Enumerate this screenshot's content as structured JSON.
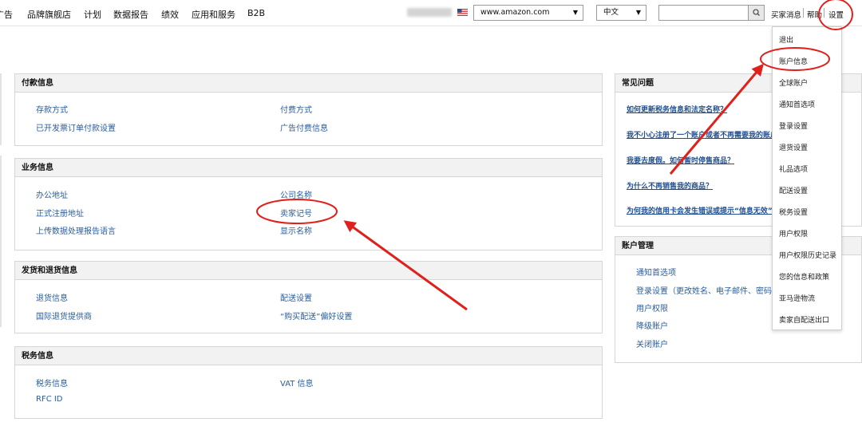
{
  "nav": {
    "items": [
      "广告",
      "品牌旗舰店",
      "计划",
      "数据报告",
      "绩效",
      "应用和服务",
      "B2B"
    ]
  },
  "header": {
    "marketplace_value": "www.amazon.com",
    "language_value": "中文",
    "search_value": "",
    "buyer_messages_label": "买家消息",
    "help_label": "帮助",
    "settings_label": "设置"
  },
  "panels": {
    "payment": {
      "title": "付款信息",
      "links": [
        "存款方式",
        "付费方式",
        "已开发票订单付款设置",
        "广告付费信息"
      ]
    },
    "business": {
      "title": "业务信息",
      "links": [
        "办公地址",
        "公司名称",
        "正式注册地址",
        "卖家记号",
        "上传数据处理报告语言",
        "显示名称"
      ]
    },
    "shipping": {
      "title": "发货和退货信息",
      "links": [
        "退货信息",
        "配送设置",
        "国际退货提供商",
        "“购买配送”偏好设置"
      ]
    },
    "tax": {
      "title": "税务信息",
      "links": [
        "税务信息",
        "VAT 信息",
        "RFC ID"
      ]
    },
    "faq": {
      "title": "常见问题",
      "links": [
        "如何更新税务信息和法定名称？",
        "我不小心注册了一个账户或者不再需要我的账户，怎样做？",
        "我要去度假。如何暂时停售商品？",
        "为什么不再销售我的商品？",
        "为何我的信用卡会发生错误或提示“信息无效”？"
      ]
    },
    "account_mgmt": {
      "title": "账户管理",
      "links": [
        "通知首选项",
        "登录设置（更改姓名、电子邮件、密码）",
        "用户权限",
        "降级账户",
        "关闭账户"
      ]
    }
  },
  "settings_menu": {
    "items": [
      "退出",
      "账户信息",
      "全球账户",
      "通知首选项",
      "登录设置",
      "退货设置",
      "礼品选项",
      "配送设置",
      "税务设置",
      "用户权限",
      "用户权限历史记录",
      "您的信息和政策",
      "亚马逊物流",
      "卖家自配送出口"
    ]
  },
  "colors": {
    "link": "#2a5d9c",
    "panel_header_bg": "#f2f2f2",
    "annotation_red": "#e0201b"
  }
}
